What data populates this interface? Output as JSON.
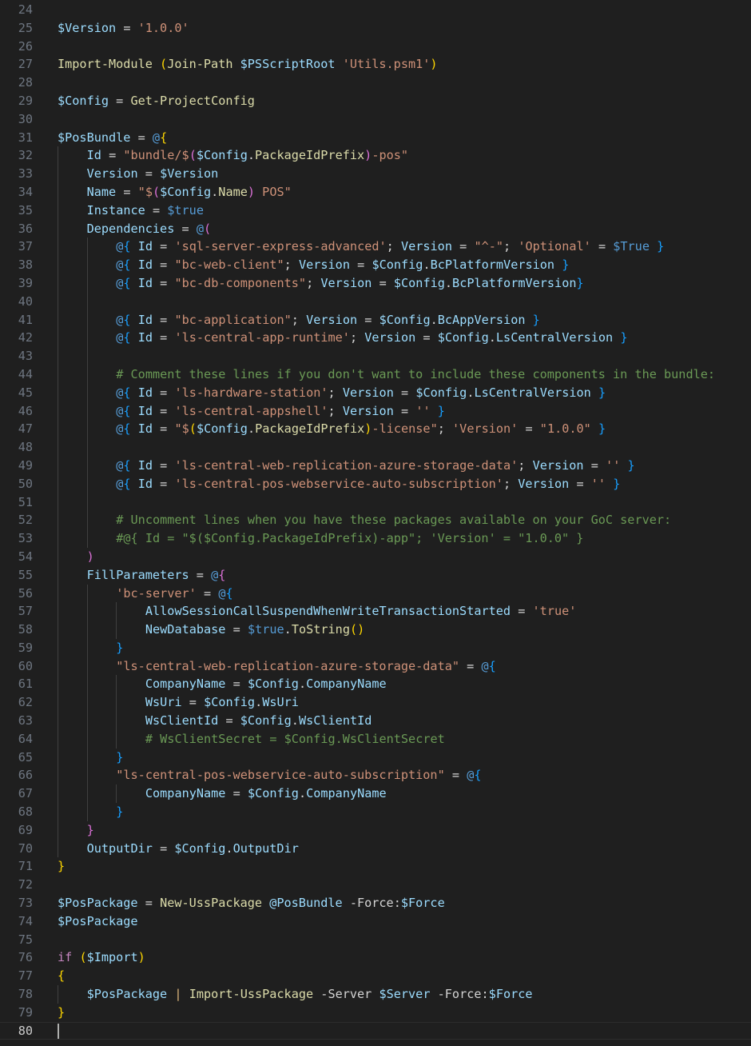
{
  "editor": {
    "first_line_number": 24,
    "current_line_number": 80,
    "lines": [
      "",
      "$Version = '1.0.0'",
      "",
      "Import-Module (Join-Path $PSScriptRoot 'Utils.psm1')",
      "",
      "$Config = Get-ProjectConfig",
      "",
      "$PosBundle = @{",
      "    Id = \"bundle/$($Config.PackageIdPrefix)-pos\"",
      "    Version = $Version",
      "    Name = \"$($Config.Name) POS\"",
      "    Instance = $true",
      "    Dependencies = @(",
      "        @{ Id = 'sql-server-express-advanced'; Version = \"^-\"; 'Optional' = $True }",
      "        @{ Id = \"bc-web-client\"; Version = $Config.BcPlatformVersion }",
      "        @{ Id = \"bc-db-components\"; Version = $Config.BcPlatformVersion}",
      "",
      "        @{ Id = \"bc-application\"; Version = $Config.BcAppVersion }",
      "        @{ Id = 'ls-central-app-runtime'; Version = $Config.LsCentralVersion }",
      "",
      "        # Comment these lines if you don't want to include these components in the bundle:",
      "        @{ Id = 'ls-hardware-station'; Version = $Config.LsCentralVersion }",
      "        @{ Id = 'ls-central-appshell'; Version = '' }",
      "        @{ Id = \"$($Config.PackageIdPrefix)-license\"; 'Version' = \"1.0.0\" }",
      "",
      "        @{ Id = 'ls-central-web-replication-azure-storage-data'; Version = '' }",
      "        @{ Id = 'ls-central-pos-webservice-auto-subscription'; Version = '' }",
      "",
      "        # Uncomment lines when you have these packages available on your GoC server:",
      "        #@{ Id = \"$($Config.PackageIdPrefix)-app\"; 'Version' = \"1.0.0\" }",
      "    )",
      "    FillParameters = @{",
      "        'bc-server' = @{",
      "            AllowSessionCallSuspendWhenWriteTransactionStarted = 'true'",
      "            NewDatabase = $true.ToString()",
      "        }",
      "        \"ls-central-web-replication-azure-storage-data\" = @{",
      "            CompanyName = $Config.CompanyName",
      "            WsUri = $Config.WsUri",
      "            WsClientId = $Config.WsClientId",
      "            # WsClientSecret = $Config.WsClientSecret",
      "        }",
      "        \"ls-central-pos-webservice-auto-subscription\" = @{",
      "            CompanyName = $Config.CompanyName",
      "        }",
      "    }",
      "    OutputDir = $Config.OutputDir",
      "}",
      "",
      "$PosPackage = New-UssPackage @PosBundle -Force:$Force",
      "$PosPackage",
      "",
      "if ($Import)",
      "{",
      "    $PosPackage | Import-UssPackage -Server $Server -Force:$Force",
      "}",
      ""
    ]
  }
}
